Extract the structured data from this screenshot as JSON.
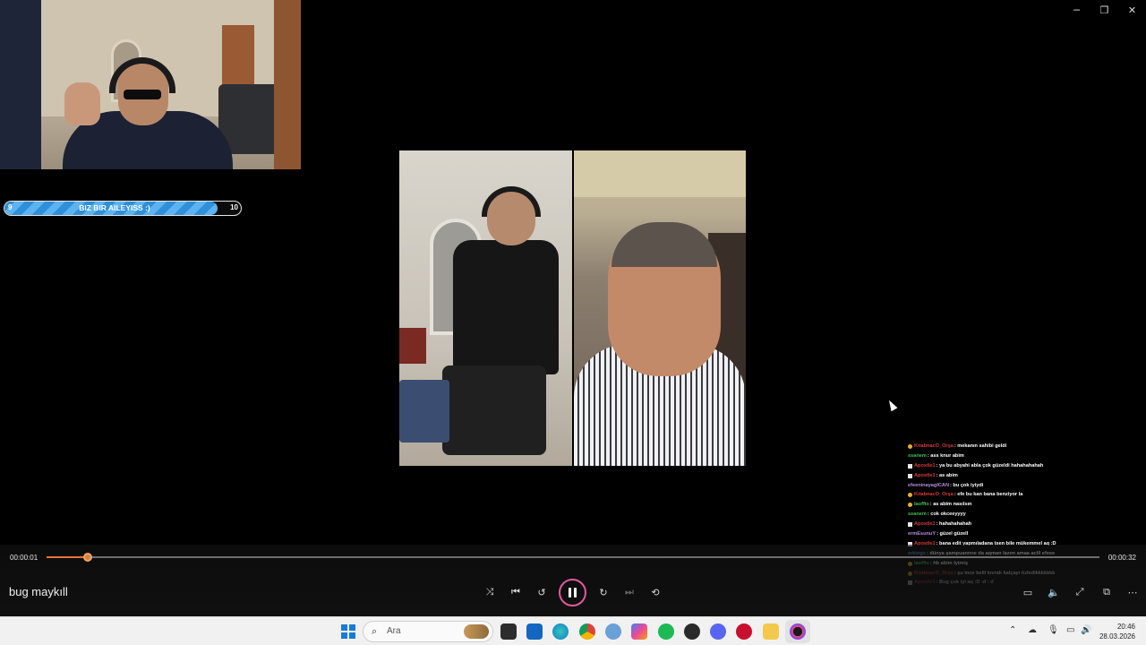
{
  "window": {
    "controls": [
      "minimize",
      "restore",
      "close"
    ]
  },
  "goal_bar": {
    "start_value": "9",
    "label": "BIZ BIR AILEYISS :)",
    "end_value": "10",
    "progress": 0.9,
    "fill_color": "#3ea2e8"
  },
  "chat": {
    "messages": [
      {
        "user": "KıtabnacO_Orşa",
        "text": ": mekanın sahibi geldi",
        "user_color": "#d83a3a",
        "badge": "sub"
      },
      {
        "user": "ssanem",
        "text": ": ass knur abim",
        "user_color": "#3fbf5a",
        "badge": "none"
      },
      {
        "user": "Apostle1",
        "text": ": ya bu abyahi abla çok güzeldi hahahahahah",
        "user_color": "#d83a3a",
        "badge": "mod"
      },
      {
        "user": "Apostle1",
        "text": ": as abim",
        "user_color": "#d83a3a",
        "badge": "mod"
      },
      {
        "user": "efeeninayagICAN",
        "text": ": bu çok iyiydi",
        "user_color": "#b58ae0",
        "badge": "none"
      },
      {
        "user": "KıtabnacO_Orşa",
        "text": ": efe bu kan bana benziyor la",
        "user_color": "#d83a3a",
        "badge": "sub"
      },
      {
        "user": "laoffio",
        "text": ": as abim nasılsın",
        "user_color": "#3fbf5a",
        "badge": "sub"
      },
      {
        "user": "ssanem",
        "text": ": cok okceeyyyy",
        "user_color": "#3fbf5a",
        "badge": "none"
      },
      {
        "user": "Apostle1",
        "text": ": hahahahahah",
        "user_color": "#d83a3a",
        "badge": "mod"
      },
      {
        "user": "ermEsunuY",
        "text": ": güzel güzell",
        "user_color": "#b58ae0",
        "badge": "none"
      },
      {
        "user": "Apostle1",
        "text": ": bana edit yapmıladana tsen bile mükemmel aq :D",
        "user_color": "#d83a3a",
        "badge": "mod"
      },
      {
        "user": "erkings",
        "text": ": dünya şampuannne da aqman lazım amaa acill efeee",
        "user_color": "#5a8ae0",
        "badge": "none"
      },
      {
        "user": "laoffio",
        "text": ": hb abim lyimiş",
        "user_color": "#3fbf5a",
        "badge": "sub"
      },
      {
        "user": "KıtabnacO_Orşa",
        "text": ": şu ince belli kıvrak kalçayı özledikkkkkkk",
        "user_color": "#d83a3a",
        "badge": "sub"
      },
      {
        "user": "Apostle1",
        "text": ": Bug çok iyi aq :D :d : d",
        "user_color": "#d83a3a",
        "badge": "mod"
      }
    ]
  },
  "player": {
    "current_time": "00:00:01",
    "total_time": "00:00:32",
    "progress": 0.039,
    "accent_color": "#e9743a",
    "title": "bug maykıll",
    "state": "playing"
  },
  "taskbar": {
    "search_placeholder": "Ara",
    "apps": [
      "windows-logo",
      "file-explorer-dark",
      "outlook",
      "edge",
      "chrome",
      "settings",
      "copilot",
      "spotify",
      "app-dark",
      "discord",
      "app-red",
      "files",
      "media-player"
    ],
    "clock_time": "20:46",
    "clock_date": "28.03.2026"
  }
}
